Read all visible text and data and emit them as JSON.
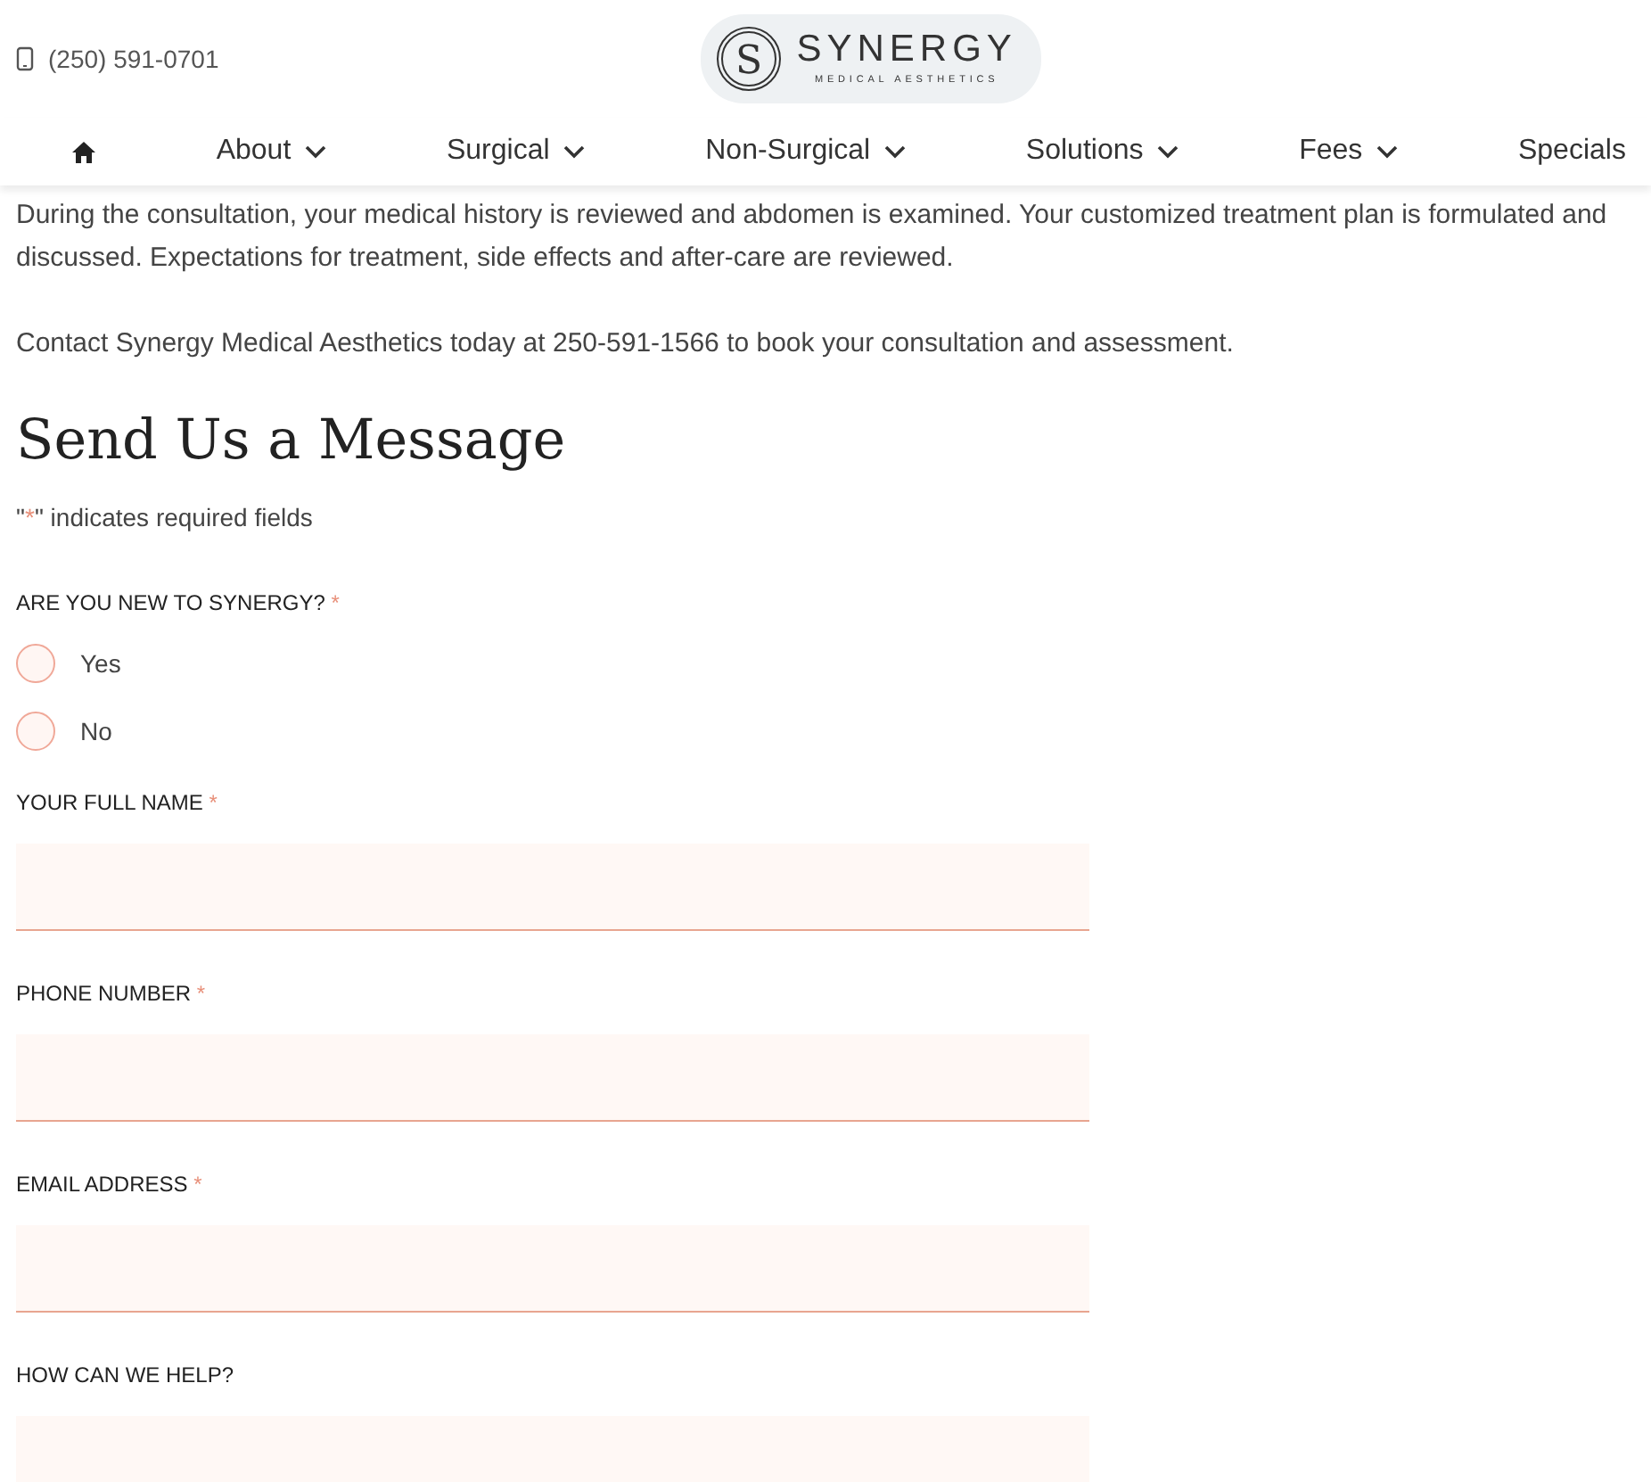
{
  "header": {
    "phone": "(250) 591-0701",
    "logo": {
      "mark": "S",
      "name": "SYNERGY",
      "tagline": "MEDICAL AESTHETICS"
    }
  },
  "nav": [
    {
      "kind": "home"
    },
    {
      "label": "About",
      "kind": "dropdown"
    },
    {
      "label": "Surgical",
      "kind": "dropdown"
    },
    {
      "label": "Non-Surgical",
      "kind": "dropdown"
    },
    {
      "label": "Solutions",
      "kind": "dropdown"
    },
    {
      "label": "Fees",
      "kind": "dropdown"
    },
    {
      "label": "Specials",
      "kind": "link"
    }
  ],
  "paragraphs": [
    "During the consultation, your medical history is reviewed and abdomen is examined. Your customized treatment plan is formulated and discussed. Expectations for treatment, side effects and after-care are reviewed.",
    "Contact Synergy Medical Aesthetics today at 250-591-1566 to book your consultation and assessment."
  ],
  "form": {
    "title": "Send Us a Message",
    "note": {
      "before": "\"",
      "mark": "*",
      "after": "\" indicates required fields"
    },
    "fields": [
      {
        "kind": "radio",
        "label": "ARE YOU NEW TO SYNERGY?",
        "required_mark": "*",
        "options": [
          {
            "label": "Yes",
            "selected": false
          },
          {
            "label": "No",
            "selected": false
          }
        ]
      },
      {
        "kind": "text",
        "label": "YOUR FULL NAME",
        "required_mark": "*"
      },
      {
        "kind": "text",
        "label": "PHONE NUMBER",
        "required_mark": "*"
      },
      {
        "kind": "text",
        "label": "EMAIL ADDRESS",
        "required_mark": "*"
      },
      {
        "kind": "textarea",
        "label": "HOW CAN WE HELP?"
      }
    ]
  }
}
